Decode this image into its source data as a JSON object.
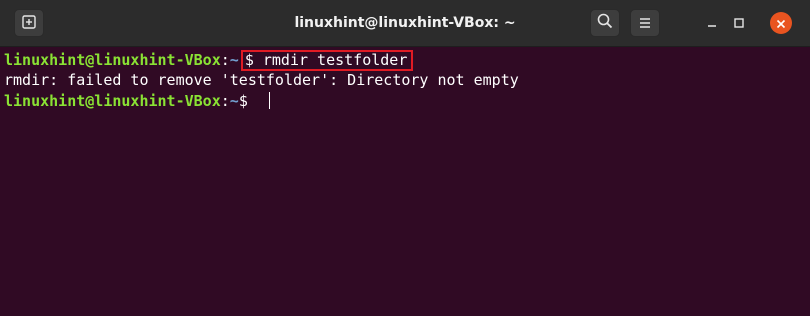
{
  "window": {
    "title": "linuxhint@linuxhint-VBox: ~",
    "new_tab_icon": "new-tab-icon",
    "search_icon": "search-icon",
    "menu_icon": "hamburger-menu-icon",
    "minimize_icon": "minimize-icon",
    "maximize_icon": "maximize-icon",
    "close_icon": "close-icon",
    "close_color": "#e95420"
  },
  "terminal": {
    "background": "#300a24",
    "lines": [
      {
        "user_host": "linuxhint@linuxhint-VBox",
        "colon": ":",
        "path": "~",
        "command": "$ rmdir testfolder",
        "highlighted": true,
        "highlight_color": "#e01b24"
      },
      {
        "output": "rmdir: failed to remove 'testfolder': Directory not empty"
      },
      {
        "user_host": "linuxhint@linuxhint-VBox",
        "colon": ":",
        "path": "~",
        "command": "$ "
      }
    ]
  }
}
